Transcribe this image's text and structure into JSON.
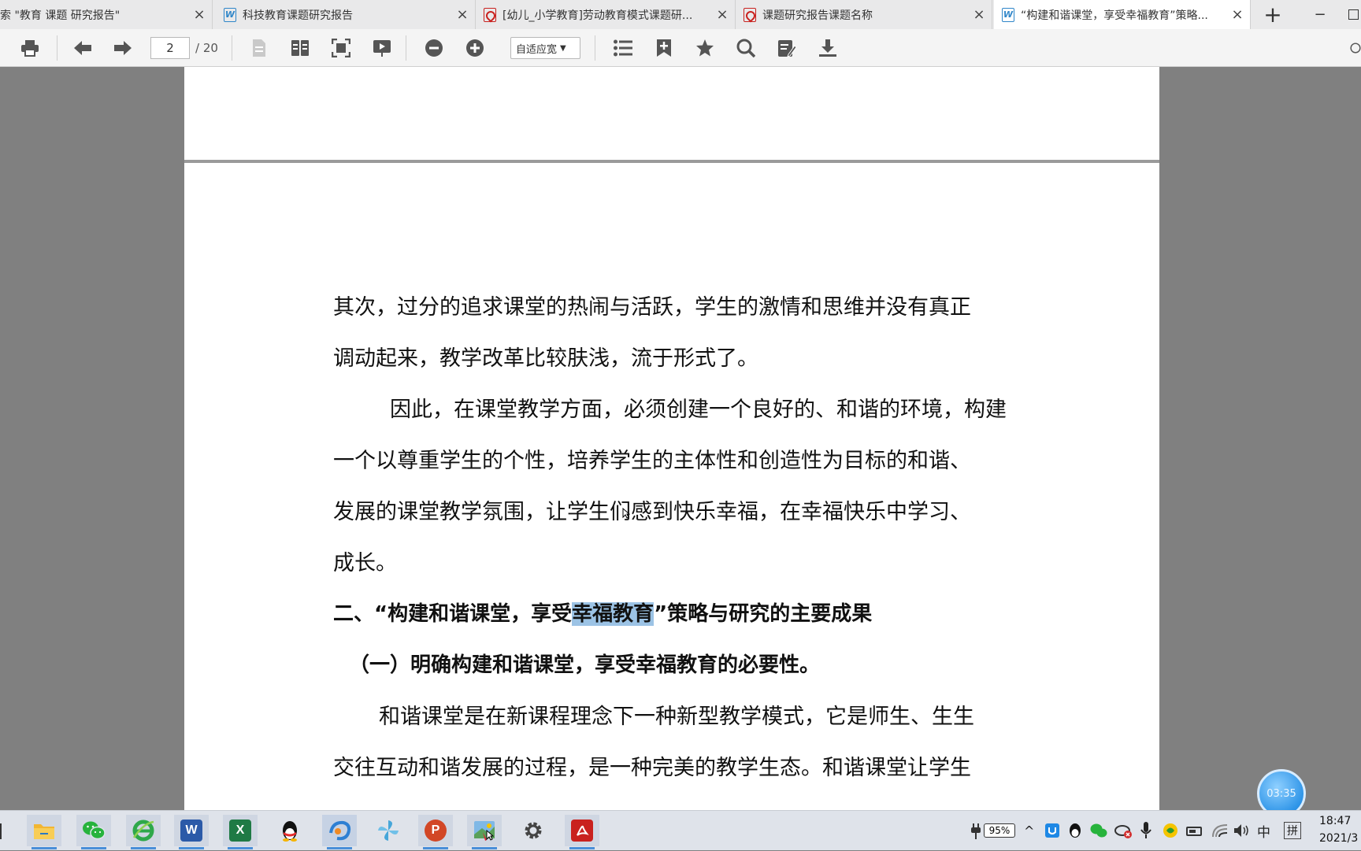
{
  "tabs": [
    {
      "label": "索 \"教育 课题 研究报告\"",
      "icon": "search-page",
      "active": false
    },
    {
      "label": "科技教育课题研究报告",
      "icon": "word-doc-icon",
      "active": false
    },
    {
      "label": "[幼儿_小学教育]劳动教育模式课题研...",
      "icon": "pdf-icon",
      "active": false
    },
    {
      "label": "课题研究报告课题名称",
      "icon": "pdf-icon",
      "active": false
    },
    {
      "label": "“构建和谐课堂，享受幸福教育”策略...",
      "icon": "word-doc-icon",
      "active": true
    }
  ],
  "tab_close": "×",
  "new_tab": "+",
  "window": {
    "minimize": "−"
  },
  "toolbar": {
    "page_current": "2",
    "page_total": "/ 20",
    "zoom": "自适应宽",
    "icons": [
      "print-icon",
      "prev-page-icon",
      "next-page-icon",
      "single-page-icon",
      "two-page-icon",
      "fit-page-icon",
      "present-icon",
      "zoom-out-icon",
      "zoom-in-icon",
      "outline-icon",
      "add-bookmark-icon",
      "bookmark-icon",
      "search-icon",
      "annotate-icon",
      "download-icon"
    ]
  },
  "document": {
    "para1": [
      "其次，过分的追求课堂的热闹与活跃，学生的激情和思维并没有真正",
      "调动起来，教学改革比较肤浅，流于形式了。"
    ],
    "para2": [
      "因此，在课堂教学方面，必须创建一个良好的、和谐的环境，构建",
      "一个以尊重学生的个性，培养学生的主体性和创造性为目标的和谐、",
      "发展的课堂教学氛围，让学生们感到快乐幸福，在幸福快乐中学习、",
      "成长。"
    ],
    "heading1": {
      "before": "二、“构建和谐课堂，享受",
      "highlight": "幸福教育",
      "after": "”策略与研究的主要成果"
    },
    "heading2": "（一）明确构建和谐课堂，享受幸福教育的必要性。",
    "para3": [
      "和谐课堂是在新课程理念下一种新型教学模式，它是师生、生生",
      "交往互动和谐发展的过程，是一种完美的教学生态。和谐课堂让学生"
    ]
  },
  "timer": "03:35",
  "taskbar": {
    "apps": [
      "file-explorer",
      "wechat",
      "ie-browser",
      "word",
      "excel",
      "qq",
      "edge-like",
      "photos",
      "powerpoint",
      "paint",
      "settings",
      "pdf-reader"
    ],
    "battery": "95%",
    "ime_lang": "中",
    "ime_mode": "拼",
    "clock_time": "18:47",
    "clock_date": "2021/3"
  },
  "colors": {
    "highlight": "#9cc3e5",
    "word_blue": "#2f86c9",
    "pdf_red": "#c9211e"
  }
}
